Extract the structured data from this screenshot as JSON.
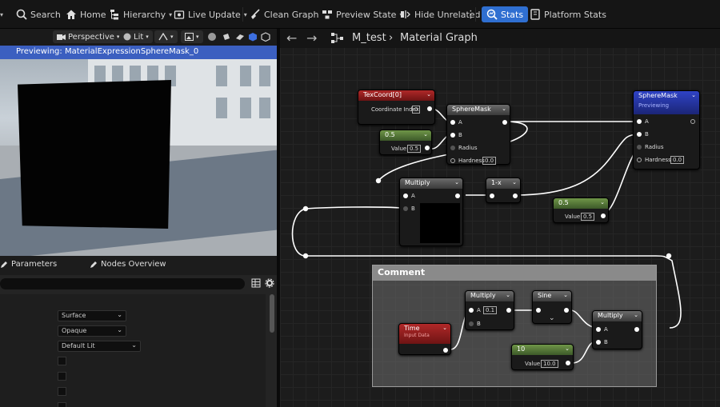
{
  "toolbar": {
    "search": "Search",
    "home": "Home",
    "hierarchy": "Hierarchy",
    "live_update": "Live Update",
    "clean_graph": "Clean Graph",
    "preview_state": "Preview State",
    "hide_unrelated": "Hide Unrelated",
    "stats": "Stats",
    "platform_stats": "Platform Stats"
  },
  "viewport": {
    "perspective": "Perspective",
    "lit": "Lit",
    "banner": "Previewing: MaterialExpressionSphereMask_0"
  },
  "details": {
    "tab_parameters": "Parameters",
    "tab_nodes_overview": "Nodes Overview",
    "combo_domain": "Surface",
    "combo_blend": "Opaque",
    "combo_shading": "Default Lit"
  },
  "graph": {
    "back": "←",
    "forward": "→",
    "material_name": "M_test",
    "separator": "›",
    "graph_name": "Material Graph",
    "nodes": {
      "texcoord": {
        "title": "TexCoord[0]",
        "param_label": "Coordinate Index",
        "param_value": "0"
      },
      "const_a": {
        "title": "0.5",
        "param_label": "Value",
        "param_value": "0.5"
      },
      "spheremask_a": {
        "title": "SphereMask",
        "a": "A",
        "b": "B",
        "radius": "Radius",
        "hardness": "Hardness",
        "hardness_value": "0.0"
      },
      "multiply_a": {
        "title": "Multiply",
        "a": "A",
        "b": "B"
      },
      "one_minus": {
        "title": "1-x"
      },
      "const_b": {
        "title": "0.5",
        "param_label": "Value",
        "param_value": "0.5"
      },
      "spheremask_b": {
        "title": "SphereMask",
        "subtitle": "Previewing",
        "a": "A",
        "b": "B",
        "radius": "Radius",
        "hardness": "Hardness",
        "hardness_value": "0.0"
      },
      "comment": {
        "title": "Comment"
      },
      "time": {
        "title": "Time",
        "subtitle": "Input Data"
      },
      "multiply_b": {
        "title": "Multiply",
        "a": "A",
        "a_value": "0.1",
        "b": "B"
      },
      "sine": {
        "title": "Sine"
      },
      "const_c": {
        "title": "10",
        "param_label": "Value",
        "param_value": "10.0"
      },
      "multiply_c": {
        "title": "Multiply",
        "a": "A",
        "b": "B"
      }
    }
  },
  "colors": {
    "stats_accent": "#2f6fd1",
    "viewport_banner": "#3b5fc0",
    "constant_node": "#6f9648",
    "math_node": "#6b6b6b",
    "input_node": "#b02828",
    "output_node": "#2f43c6"
  }
}
